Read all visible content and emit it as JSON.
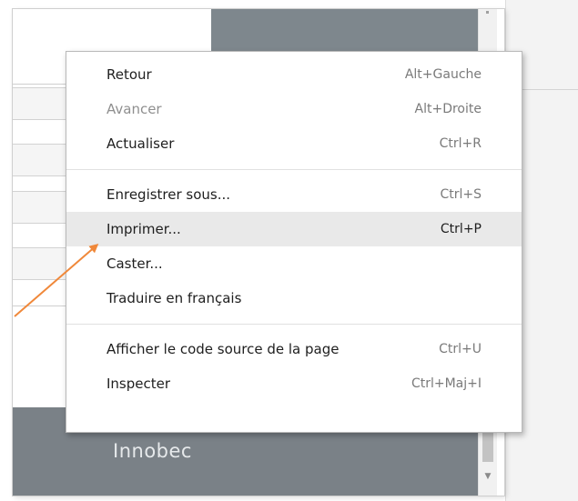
{
  "page": {
    "footer_brand": "Innobec"
  },
  "context_menu": {
    "groups": [
      [
        {
          "label": "Retour",
          "shortcut": "Alt+Gauche",
          "state": "enabled"
        },
        {
          "label": "Avancer",
          "shortcut": "Alt+Droite",
          "state": "disabled"
        },
        {
          "label": "Actualiser",
          "shortcut": "Ctrl+R",
          "state": "enabled"
        }
      ],
      [
        {
          "label": "Enregistrer sous...",
          "shortcut": "Ctrl+S",
          "state": "enabled"
        },
        {
          "label": "Imprimer...",
          "shortcut": "Ctrl+P",
          "state": "highlighted"
        },
        {
          "label": "Caster...",
          "shortcut": "",
          "state": "enabled"
        },
        {
          "label": "Traduire en français",
          "shortcut": "",
          "state": "enabled"
        }
      ],
      [
        {
          "label": "Afficher le code source de la page",
          "shortcut": "Ctrl+U",
          "state": "enabled"
        },
        {
          "label": "Inspecter",
          "shortcut": "Ctrl+Maj+I",
          "state": "enabled"
        }
      ]
    ]
  },
  "colors": {
    "header_block": "#7e878d",
    "footer_band": "#7a8187",
    "highlight": "#e9e9e9",
    "annotation_arrow": "#f0883a"
  },
  "icons": {
    "scroll_down": "chevron-down-icon",
    "annotation": "pointer-arrow-icon"
  }
}
